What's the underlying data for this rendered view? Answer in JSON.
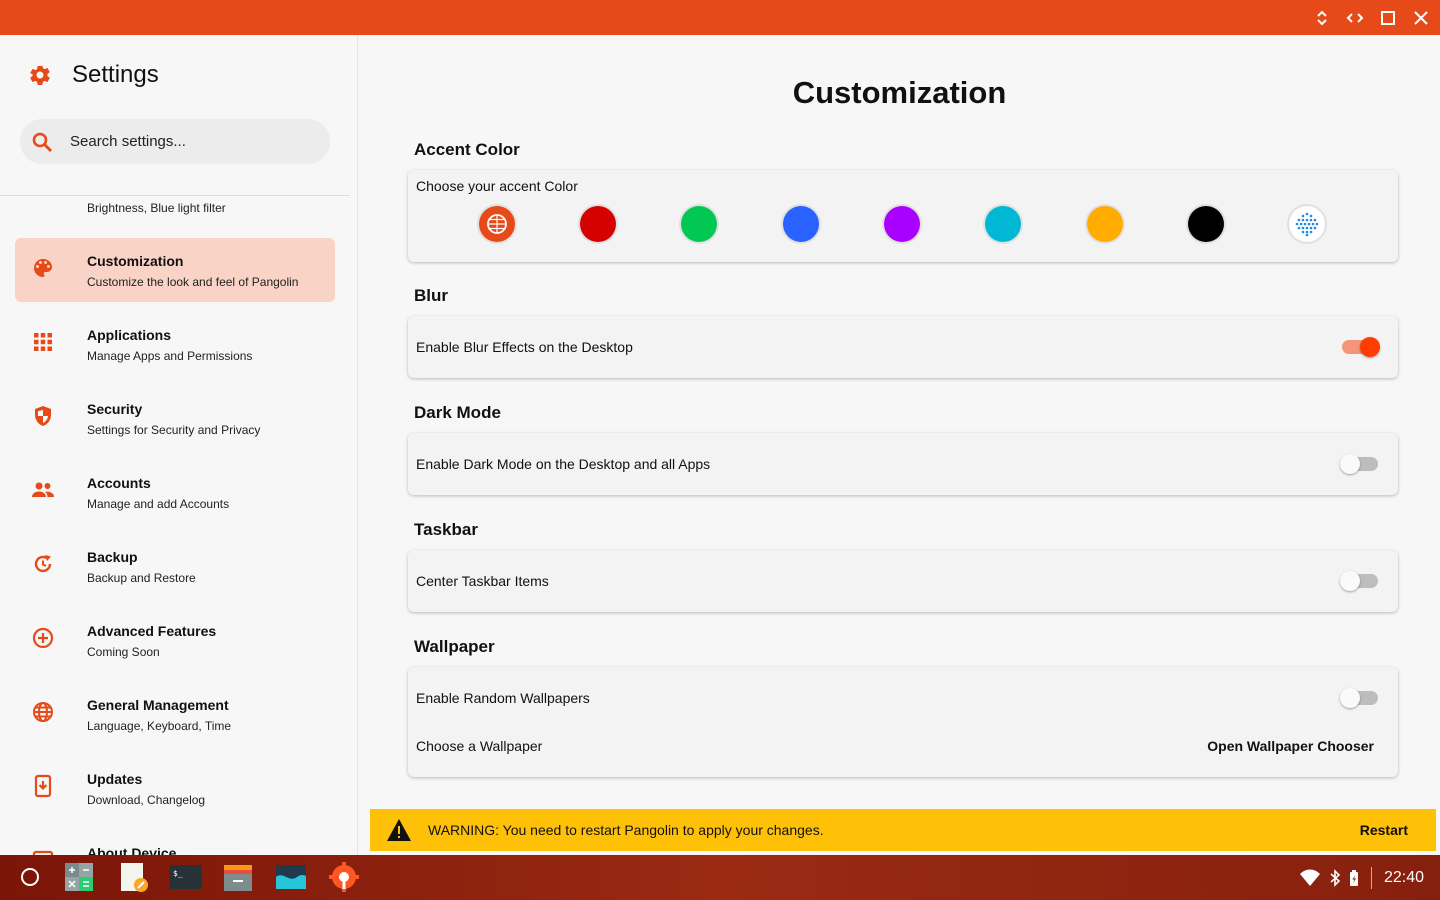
{
  "titlebar": {
    "color": "#e64a19",
    "controls": [
      "collapse-icon",
      "code-icon",
      "maximize-icon",
      "close-icon"
    ]
  },
  "sidebar": {
    "title": "Settings",
    "search_placeholder": "Search settings...",
    "partial_item_sub": "Brightness, Blue light filter",
    "items": [
      {
        "label": "Customization",
        "sub": "Customize the look and feel of Pangolin",
        "icon": "palette-icon",
        "active": true
      },
      {
        "label": "Applications",
        "sub": "Manage Apps and Permissions",
        "icon": "apps-grid-icon"
      },
      {
        "label": "Security",
        "sub": "Settings for Security and Privacy",
        "icon": "shield-icon"
      },
      {
        "label": "Accounts",
        "sub": "Manage and add Accounts",
        "icon": "people-icon"
      },
      {
        "label": "Backup",
        "sub": "Backup and Restore",
        "icon": "restore-icon"
      },
      {
        "label": "Advanced Features",
        "sub": "Coming Soon",
        "icon": "add-circle-icon"
      },
      {
        "label": "General Management",
        "sub": "Language, Keyboard, Time",
        "icon": "globe-icon"
      },
      {
        "label": "Updates",
        "sub": "Download, Changelog",
        "icon": "system-update-icon"
      },
      {
        "label": "About Device",
        "sub": "",
        "icon": "info-icon"
      }
    ]
  },
  "main": {
    "title": "Customization",
    "accent": {
      "section": "Accent Color",
      "prompt": "Choose your accent Color",
      "colors": [
        "#e64a19",
        "#d50000",
        "#00c853",
        "#2962ff",
        "#aa00ff",
        "#00b8d4",
        "#ffab00",
        "#000000",
        "#ffffff"
      ],
      "selected": 0
    },
    "blur": {
      "section": "Blur",
      "label": "Enable Blur Effects on the Desktop",
      "enabled": true
    },
    "dark_mode": {
      "section": "Dark Mode",
      "label": "Enable Dark Mode on the Desktop and all Apps",
      "enabled": false
    },
    "taskbar": {
      "section": "Taskbar",
      "label": "Center Taskbar Items",
      "enabled": false
    },
    "wallpaper": {
      "section": "Wallpaper",
      "random_label": "Enable Random Wallpapers",
      "random_enabled": false,
      "choose_label": "Choose a Wallpaper",
      "chooser_button": "Open Wallpaper Chooser"
    },
    "warning": {
      "text": "WARNING: You need to restart Pangolin to apply your changes.",
      "action": "Restart",
      "color": "#ffc107"
    }
  },
  "taskbar": {
    "apps": [
      "launcher-icon",
      "calculator-icon",
      "text-editor-icon",
      "terminal-icon",
      "files-icon",
      "image-viewer-icon",
      "settings-app-icon"
    ],
    "clock": "22:40"
  }
}
